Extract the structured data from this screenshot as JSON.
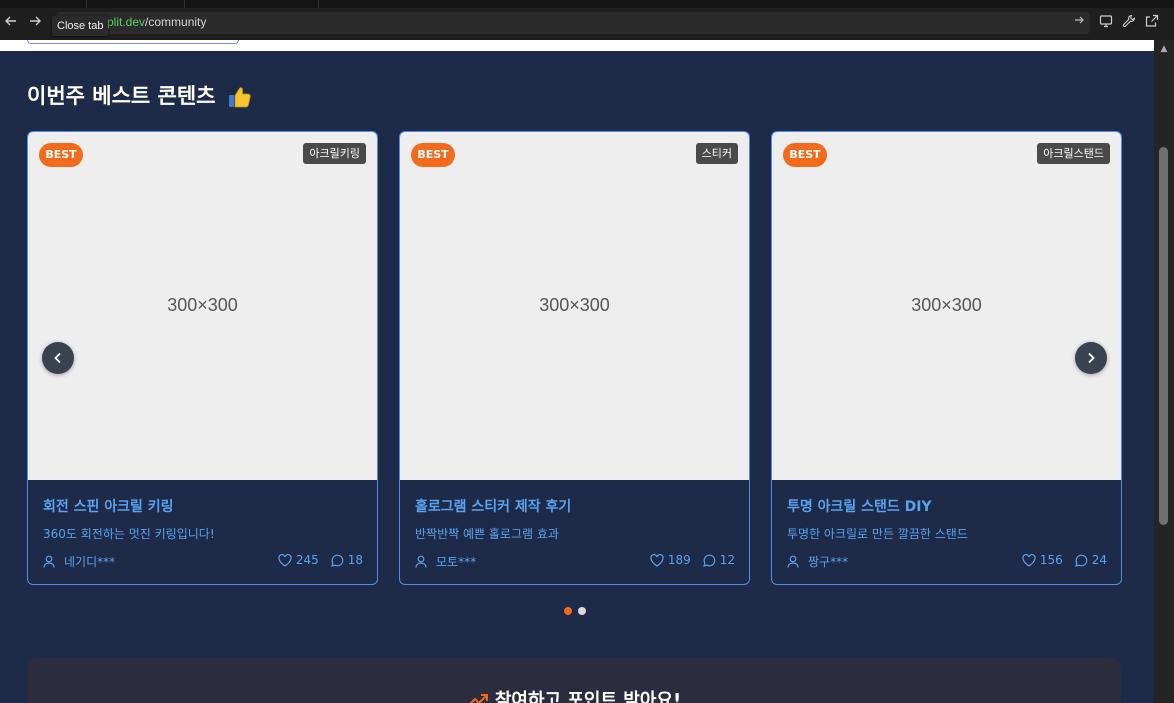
{
  "browser": {
    "url_host": "plit.dev",
    "url_path": "/community",
    "tooltip": "Close tab",
    "icons": [
      "back-arrow-icon",
      "forward-arrow-icon",
      "go-arrow-icon",
      "monitor-icon",
      "wrench-icon",
      "external-link-icon"
    ]
  },
  "section": {
    "title": "이번주 베스트 콘텐츠",
    "title_icon": "thumbs-up-icon"
  },
  "cards": [
    {
      "badge": "BEST",
      "category": "아크릴키링",
      "image_label": "300×300",
      "title": "회전 스핀 아크릴 키링",
      "desc": "360도 회전하는 멋진 키링입니다!",
      "author": "네기디***",
      "likes": "245",
      "comments": "18"
    },
    {
      "badge": "BEST",
      "category": "스티커",
      "image_label": "300×300",
      "title": "홀로그램 스티커 제작 후기",
      "desc": "반짝반짝 예쁜 홀로그램 효과",
      "author": "모토***",
      "likes": "189",
      "comments": "12"
    },
    {
      "badge": "BEST",
      "category": "아크릴스탠드",
      "image_label": "300×300",
      "title": "투명 아크릴 스탠드 DIY",
      "desc": "투명한 아크릴로 만든 깔끔한 스탠드",
      "author": "짱구***",
      "likes": "156",
      "comments": "24"
    }
  ],
  "carousel": {
    "active_dot": 0,
    "dot_count": 2,
    "colors": {
      "active": "#f26b1d",
      "inactive": "#d9d9d9"
    }
  },
  "promo": {
    "title": "참여하고 포인트 받아요!",
    "icon": "trending-up-icon"
  },
  "colors": {
    "background": "#1d2a48",
    "accent": "#5aa3f0",
    "best": "#f26b1d"
  }
}
